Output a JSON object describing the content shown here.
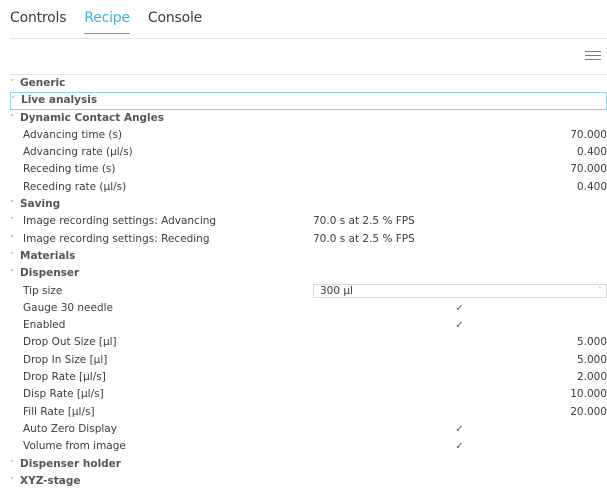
{
  "tabs": [
    {
      "label": "Controls",
      "active": false
    },
    {
      "label": "Recipe",
      "active": true
    },
    {
      "label": "Console",
      "active": false
    }
  ],
  "toolbar": {
    "menu_icon": "hamburger-menu-icon"
  },
  "tree": {
    "generic": {
      "label": "Generic",
      "expanded": false
    },
    "live_analysis": {
      "label": "Live analysis",
      "expanded": false
    },
    "dca": {
      "label": "Dynamic Contact Angles",
      "expanded": true,
      "advancing_time": {
        "label": "Advancing time (s)",
        "value": "70.000"
      },
      "advancing_rate": {
        "label": "Advancing rate (µl/s)",
        "value": "0.400"
      },
      "receding_time": {
        "label": "Receding time (s)",
        "value": "70.000"
      },
      "receding_rate": {
        "label": "Receding rate (µl/s)",
        "value": "0.400"
      }
    },
    "saving": {
      "label": "Saving",
      "expanded": true,
      "img_adv": {
        "label": "Image recording settings: Advancing",
        "value": "70.0 s at 2.5 % FPS"
      },
      "img_rec": {
        "label": "Image recording settings: Receding",
        "value": "70.0 s at 2.5 % FPS"
      }
    },
    "materials": {
      "label": "Materials",
      "expanded": false
    },
    "dispenser": {
      "label": "Dispenser",
      "expanded": true,
      "tip_size": {
        "label": "Tip size",
        "value": "300 µl"
      },
      "gauge": {
        "label": "Gauge 30 needle",
        "checked": true
      },
      "enabled": {
        "label": "Enabled",
        "checked": true
      },
      "drop_out": {
        "label": "Drop Out Size [µl]",
        "value": "5.000"
      },
      "drop_in": {
        "label": "Drop In Size [µl]",
        "value": "5.000"
      },
      "drop_rate": {
        "label": "Drop Rate [µl/s]",
        "value": "2.000"
      },
      "disp_rate": {
        "label": "Disp Rate [µl/s]",
        "value": "10.000"
      },
      "fill_rate": {
        "label": "Fill Rate [µl/s]",
        "value": "20.000"
      },
      "auto_zero": {
        "label": "Auto Zero Display",
        "checked": true
      },
      "vol_image": {
        "label": "Volume from image",
        "checked": true
      }
    },
    "dispenser_holder": {
      "label": "Dispenser holder",
      "expanded": false
    },
    "xyz_stage": {
      "label": "XYZ-stage",
      "expanded": false
    }
  },
  "glyphs": {
    "collapsed": "˅",
    "expanded": "˄",
    "check": "✓",
    "dropdown": "˅"
  }
}
